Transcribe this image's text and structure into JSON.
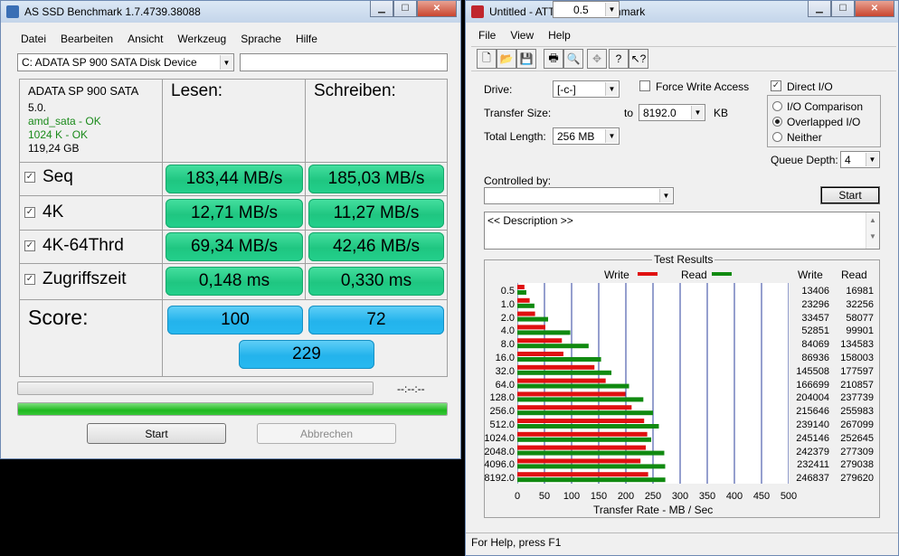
{
  "as_ssd": {
    "title": "AS SSD Benchmark 1.7.4739.38088",
    "menu": [
      "Datei",
      "Bearbeiten",
      "Ansicht",
      "Werkzeug",
      "Sprache",
      "Hilfe"
    ],
    "drive_select": "C: ADATA SP 900 SATA Disk Device",
    "drive_info": {
      "model": "ADATA SP 900 SATA",
      "firmware": "5.0.",
      "driver": "amd_sata - OK",
      "alignment": "1024 K - OK",
      "size": "119,24 GB"
    },
    "headers": {
      "read": "Lesen:",
      "write": "Schreiben:"
    },
    "rows": [
      {
        "label": "Seq",
        "read": "183,44 MB/s",
        "write": "185,03 MB/s"
      },
      {
        "label": "4K",
        "read": "12,71 MB/s",
        "write": "11,27 MB/s"
      },
      {
        "label": "4K-64Thrd",
        "read": "69,34 MB/s",
        "write": "42,46 MB/s"
      },
      {
        "label": "Zugriffszeit",
        "read": "0,148 ms",
        "write": "0,330 ms"
      }
    ],
    "score": {
      "label": "Score:",
      "read": "100",
      "write": "72",
      "total": "229"
    },
    "time": "--:--:--",
    "progress_fraction": 1.0,
    "start_label": "Start",
    "abort_label": "Abbrechen",
    "accent_green": "#1fc681",
    "accent_blue": "#23b3ec"
  },
  "atto": {
    "title": "Untitled - ATTO Disk Benchmark",
    "menu": [
      "File",
      "View",
      "Help"
    ],
    "toolbar_icons": [
      "new-icon",
      "open-icon",
      "save-icon",
      "print-icon",
      "print-preview-icon",
      "move-icon",
      "help-icon",
      "context-help-icon"
    ],
    "drive_label": "Drive:",
    "drive_value": "[-c-]",
    "transfer_size_label": "Transfer Size:",
    "transfer_from": "0.5",
    "to_label": "to",
    "transfer_to": "8192.0",
    "kb_label": "KB",
    "total_length_label": "Total Length:",
    "total_length_value": "256 MB",
    "force_write_label": "Force Write Access",
    "direct_io_label": "Direct I/O",
    "io_comparison_label": "I/O Comparison",
    "overlapped_io_label": "Overlapped I/O",
    "neither_label": "Neither",
    "queue_depth_label": "Queue Depth:",
    "queue_depth_value": "4",
    "controlled_by_label": "Controlled by:",
    "start_label": "Start",
    "description": "<< Description >>",
    "results_title": "Test Results",
    "legend_write": "Write",
    "legend_read": "Read",
    "col_write": "Write",
    "col_read": "Read",
    "status": "For Help, press F1",
    "write_color": "#e01010",
    "read_color": "#108a10"
  },
  "chart_data": {
    "type": "bar",
    "title": "Test Results",
    "xlabel": "Transfer Rate - MB / Sec",
    "ylabel": "",
    "xlim": [
      0,
      500
    ],
    "x_ticks": [
      "0",
      "50",
      "100",
      "150",
      "200",
      "250",
      "300",
      "350",
      "400",
      "450",
      "500"
    ],
    "categories": [
      "0.5",
      "1.0",
      "2.0",
      "4.0",
      "8.0",
      "16.0",
      "32.0",
      "64.0",
      "128.0",
      "256.0",
      "512.0",
      "1024.0",
      "2048.0",
      "4096.0",
      "8192.0"
    ],
    "series": [
      {
        "name": "Write",
        "values": [
          13.1,
          22.7,
          32.7,
          51.6,
          82.1,
          84.9,
          142.1,
          162.8,
          199.2,
          210.6,
          233.7,
          239.4,
          236.7,
          226.97,
          241.05
        ]
      },
      {
        "name": "Read",
        "values": [
          16.6,
          31.5,
          56.7,
          97.6,
          131.4,
          154.3,
          173.4,
          205.9,
          232.2,
          250.0,
          260.8,
          246.7,
          270.8,
          272.5,
          272.7
        ]
      }
    ],
    "write_labels": [
      "13406",
      "23296",
      "33457",
      "52851",
      "84069",
      "86936",
      "145508",
      "166699",
      "204004",
      "215646",
      "239140",
      "245146",
      "242379",
      "232411",
      "246837"
    ],
    "read_labels": [
      "16981",
      "32256",
      "58077",
      "99901",
      "134583",
      "158003",
      "177597",
      "210857",
      "237739",
      "255983",
      "267099",
      "252645",
      "277309",
      "279038",
      "279620"
    ],
    "legend": "top",
    "grid": true
  }
}
